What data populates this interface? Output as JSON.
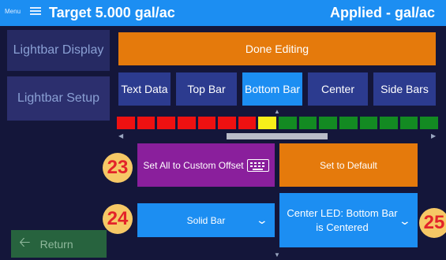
{
  "header": {
    "menu_label": "Menu",
    "target": "Target 5.000 gal/ac",
    "applied": "Applied - gal/ac",
    "color": "#1c8ef2"
  },
  "nav": {
    "lightbar_display": "Lightbar Display",
    "lightbar_setup": "Lightbar Setup",
    "return": "Return"
  },
  "done_editing": "Done Editing",
  "tabs": [
    {
      "label": "Text Data",
      "active": false
    },
    {
      "label": "Top Bar",
      "active": false
    },
    {
      "label": "Bottom Bar",
      "active": true
    },
    {
      "label": "Center",
      "active": false
    },
    {
      "label": "Side Bars",
      "active": false
    }
  ],
  "led_strip": {
    "colors": [
      "red",
      "red",
      "red",
      "red",
      "red",
      "red",
      "red",
      "yellow",
      "green",
      "green",
      "green",
      "green",
      "green",
      "green",
      "green",
      "green"
    ],
    "palette": {
      "red": "#ee1111",
      "yellow": "#f7f01a",
      "green": "#138a22"
    }
  },
  "buttons": {
    "custom_offset": "Set All to Custom Offset",
    "set_default": "Set to Default",
    "solid_bar": "Solid Bar",
    "center_led_line1": "Center LED: Bottom Bar",
    "center_led_line2": "is Centered"
  },
  "callouts": {
    "c23": "23",
    "c24": "24",
    "c25": "25"
  }
}
